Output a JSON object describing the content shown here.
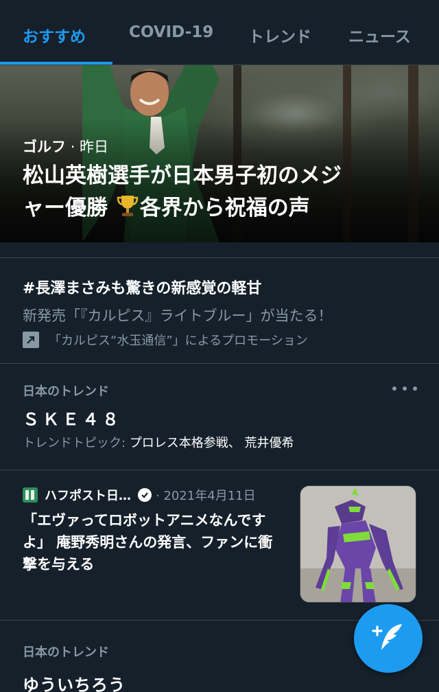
{
  "tabs": [
    {
      "label": "おすすめ"
    },
    {
      "label": "COVID-19"
    },
    {
      "label": "トレンド"
    },
    {
      "label": "ニュース"
    }
  ],
  "hero": {
    "category": "ゴルフ",
    "time": "昨日",
    "title_line1": "松山英樹選手が日本男子初のメジ",
    "title_line2_a": "ャー優勝",
    "title_line2_b": "各界から祝福の声"
  },
  "promo": {
    "title": "#長澤まさみも驚きの新感覚の軽甘",
    "description": "新発売「『カルピス』ライトブルー」が当たる！",
    "promoted_by": "「カルピス“水玉通信”」によるプロモーション"
  },
  "trend1": {
    "context": "日本のトレンド",
    "name": "ＳＫＥ４８",
    "topics_label": "トレンドトピック: ",
    "topics": "プロレス本格参戦、 荒井優希"
  },
  "news": {
    "source": "ハフポスト日…",
    "date": "· 2021年4月11日",
    "title": "「エヴァってロボットアニメなんですよ」 庵野秀明さんの発言、ファンに衝撃を与える"
  },
  "trend2": {
    "context": "日本のトレンド",
    "name": "ゆういちろう"
  },
  "colors": {
    "background": "#15202b",
    "accent": "#1d9bf0",
    "muted_text": "#8899a6",
    "divider": "#38444d"
  },
  "icons": {
    "trophy": "trophy-icon",
    "promoted": "promoted-arrow-icon",
    "more": "more-dots-icon",
    "verified": "verified-badge-icon",
    "compose": "compose-tweet-icon"
  }
}
